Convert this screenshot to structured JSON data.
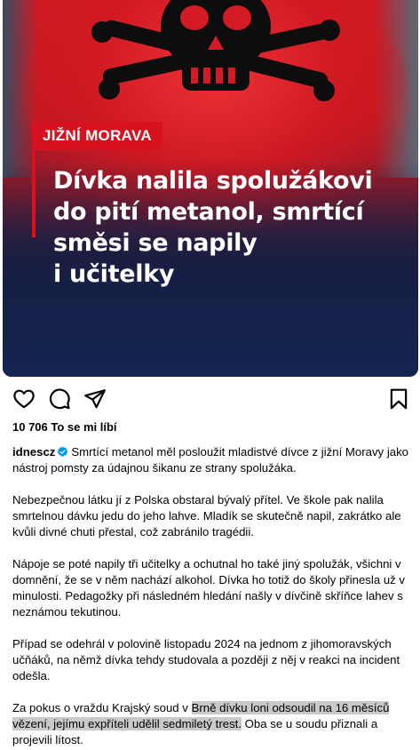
{
  "post": {
    "region_tag": "JIŽNÍ MORAVA",
    "headline_lines": [
      "Dívka nalila spolužákovi",
      "do pití metanol, smrtící",
      "směsi se napily",
      "i učitelky"
    ]
  },
  "actions": {
    "like_icon": "heart-icon",
    "comment_icon": "comment-icon",
    "share_icon": "send-icon",
    "save_icon": "bookmark-icon"
  },
  "likes": {
    "text": "10 706 To se mi líbí"
  },
  "caption": {
    "username": "idnescz",
    "first": "Smrtící metanol měl posloužit mladistvé dívce z jižní Moravy jako nástroj pomsty za údajnou šikanu ze strany spolužáka.",
    "p2": "Nebezpečnou látku jí z Polska obstaral bývalý přítel. Ve škole pak nalila smrtelnou dávku jedu do jeho lahve. Mladík se skutečně napil, zakrátko ale kvůli divné chuti přestal, což zabránilo tragédii.",
    "p3": "Nápoje se poté napily tři učitelky a ochutnal ho také jiný spolužák, všichni v domnění, že se v něm nachází alkohol. Dívka ho totiž do školy přinesla už v minulosti. Pedagožky při následném hledání našly v dívčině skříňce lahev s neznámou tekutinou.",
    "p4": "Případ se odehrál v polovině listopadu 2024 na jednom z jihomoravských učňáků, na němž dívka tehdy studovala a později z něj v reakci na incident odešla.",
    "p5_a": "Za pokus o vraždu Krajský soud v ",
    "p5_highlight": "Brně dívku loni odsoudil na 16 měsíců vězení, jejímu expříteli udělil sedmiletý trest.",
    "p5_b": " Oba se u soudu přiznali a projevili lítost."
  },
  "colors": {
    "accent_red": "#d7111f",
    "verified_blue": "#0095f6",
    "highlight": "#c9c9c9"
  }
}
